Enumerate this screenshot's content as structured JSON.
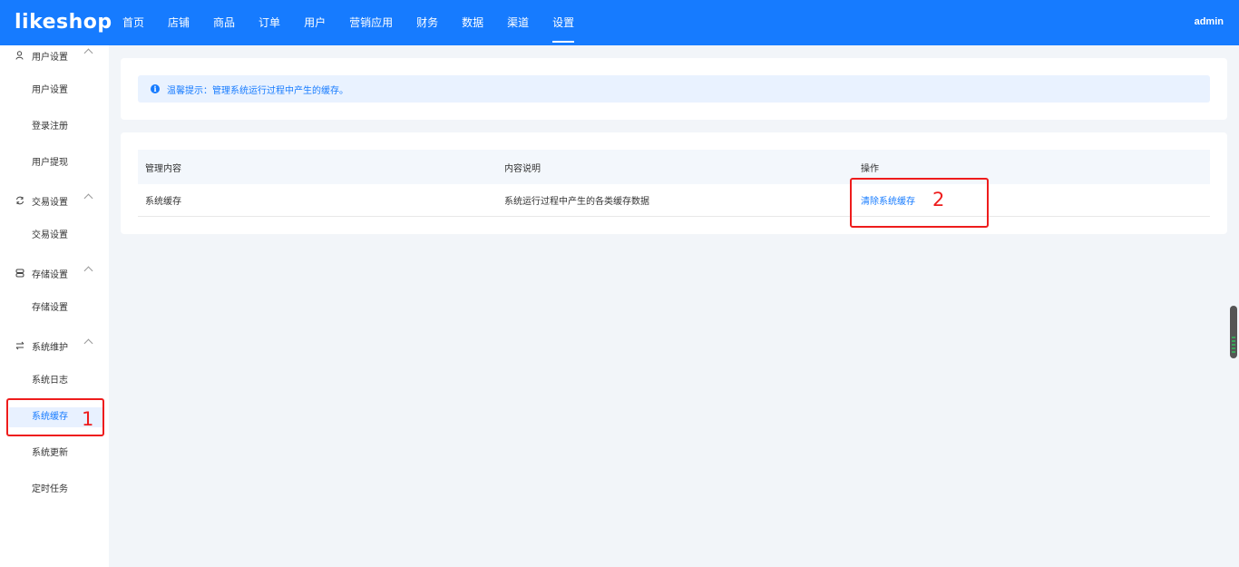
{
  "header": {
    "logo": "likeshop",
    "nav": [
      {
        "label": "首页"
      },
      {
        "label": "店铺"
      },
      {
        "label": "商品"
      },
      {
        "label": "订单"
      },
      {
        "label": "用户"
      },
      {
        "label": "营销应用"
      },
      {
        "label": "财务"
      },
      {
        "label": "数据"
      },
      {
        "label": "渠道"
      },
      {
        "label": "设置",
        "active": true
      }
    ],
    "user": "admin",
    "bg_color": "#167bff"
  },
  "sidebar": {
    "groups": [
      {
        "label": "用户设置",
        "icon": "user-settings-icon",
        "items": [
          "用户设置",
          "登录注册",
          "用户提现"
        ]
      },
      {
        "label": "交易设置",
        "icon": "exchange-icon",
        "items": [
          "交易设置"
        ]
      },
      {
        "label": "存储设置",
        "icon": "storage-icon",
        "items": [
          "存储设置"
        ]
      },
      {
        "label": "系统维护",
        "icon": "maintenance-icon",
        "items": [
          "系统日志",
          "系统缓存",
          "系统更新",
          "定时任务"
        ]
      }
    ],
    "active_item": "系统缓存"
  },
  "tip": {
    "text": "温馨提示：管理系统运行过程中产生的缓存。"
  },
  "table": {
    "columns": [
      "管理内容",
      "内容说明",
      "操作"
    ],
    "rows": [
      {
        "content": "系统缓存",
        "desc": "系统运行过程中产生的各类缓存数据",
        "action": "清除系统缓存"
      }
    ]
  },
  "annotations": [
    "1",
    "2"
  ],
  "accent_color": "#167bff",
  "annotation_color": "#ee1c1c"
}
